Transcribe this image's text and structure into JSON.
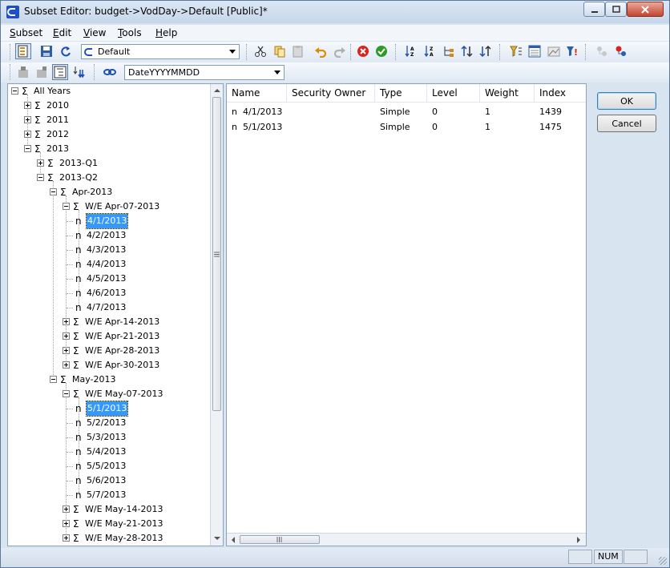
{
  "window": {
    "title": "Subset Editor: budget->VodDay->Default  [Public]*"
  },
  "menu": {
    "items": [
      {
        "label": "Subset",
        "key": "S"
      },
      {
        "label": "Edit",
        "key": "E"
      },
      {
        "label": "View",
        "key": "V"
      },
      {
        "label": "Tools",
        "key": "T"
      },
      {
        "label": "Help",
        "key": "H"
      }
    ]
  },
  "toolbar": {
    "subset_value": "Default",
    "attribute_value": "DateYYYYMMDD"
  },
  "tree": {
    "consolidated_icon": "Σ",
    "leaf_icon": "n",
    "nodes": [
      {
        "label": "All Years",
        "level": 0,
        "type": "consolidated",
        "state": "expanded"
      },
      {
        "label": "2010",
        "level": 1,
        "type": "consolidated",
        "state": "collapsed"
      },
      {
        "label": "2011",
        "level": 1,
        "type": "consolidated",
        "state": "collapsed"
      },
      {
        "label": "2012",
        "level": 1,
        "type": "consolidated",
        "state": "collapsed"
      },
      {
        "label": "2013",
        "level": 1,
        "type": "consolidated",
        "state": "expanded"
      },
      {
        "label": "2013-Q1",
        "level": 2,
        "type": "consolidated",
        "state": "collapsed"
      },
      {
        "label": "2013-Q2",
        "level": 2,
        "type": "consolidated",
        "state": "expanded"
      },
      {
        "label": "Apr-2013",
        "level": 3,
        "type": "consolidated",
        "state": "expanded"
      },
      {
        "label": "W/E Apr-07-2013",
        "level": 4,
        "type": "consolidated",
        "state": "expanded"
      },
      {
        "label": "4/1/2013",
        "level": 5,
        "type": "leaf",
        "selected": true
      },
      {
        "label": "4/2/2013",
        "level": 5,
        "type": "leaf"
      },
      {
        "label": "4/3/2013",
        "level": 5,
        "type": "leaf"
      },
      {
        "label": "4/4/2013",
        "level": 5,
        "type": "leaf"
      },
      {
        "label": "4/5/2013",
        "level": 5,
        "type": "leaf"
      },
      {
        "label": "4/6/2013",
        "level": 5,
        "type": "leaf"
      },
      {
        "label": "4/7/2013",
        "level": 5,
        "type": "leaf"
      },
      {
        "label": "W/E Apr-14-2013",
        "level": 4,
        "type": "consolidated",
        "state": "collapsed"
      },
      {
        "label": "W/E Apr-21-2013",
        "level": 4,
        "type": "consolidated",
        "state": "collapsed"
      },
      {
        "label": "W/E Apr-28-2013",
        "level": 4,
        "type": "consolidated",
        "state": "collapsed"
      },
      {
        "label": "W/E Apr-30-2013",
        "level": 4,
        "type": "consolidated",
        "state": "collapsed"
      },
      {
        "label": "May-2013",
        "level": 3,
        "type": "consolidated",
        "state": "expanded"
      },
      {
        "label": "W/E May-07-2013",
        "level": 4,
        "type": "consolidated",
        "state": "expanded"
      },
      {
        "label": "5/1/2013",
        "level": 5,
        "type": "leaf",
        "selected": true
      },
      {
        "label": "5/2/2013",
        "level": 5,
        "type": "leaf"
      },
      {
        "label": "5/3/2013",
        "level": 5,
        "type": "leaf"
      },
      {
        "label": "5/4/2013",
        "level": 5,
        "type": "leaf"
      },
      {
        "label": "5/5/2013",
        "level": 5,
        "type": "leaf"
      },
      {
        "label": "5/6/2013",
        "level": 5,
        "type": "leaf"
      },
      {
        "label": "5/7/2013",
        "level": 5,
        "type": "leaf"
      },
      {
        "label": "W/E May-14-2013",
        "level": 4,
        "type": "consolidated",
        "state": "collapsed"
      },
      {
        "label": "W/E May-21-2013",
        "level": 4,
        "type": "consolidated",
        "state": "collapsed"
      },
      {
        "label": "W/E May-28-2013",
        "level": 4,
        "type": "consolidated",
        "state": "collapsed"
      }
    ]
  },
  "list": {
    "columns": [
      "Name",
      "Security Owner",
      "Type",
      "Level",
      "Weight",
      "Index"
    ],
    "rows": [
      {
        "name": "4/1/2013",
        "owner": "",
        "type": "Simple",
        "level": "0",
        "weight": "1",
        "index": "1439"
      },
      {
        "name": "5/1/2013",
        "owner": "",
        "type": "Simple",
        "level": "0",
        "weight": "1",
        "index": "1475"
      }
    ]
  },
  "buttons": {
    "ok": "OK",
    "cancel": "Cancel"
  },
  "status": {
    "num": "NUM"
  }
}
